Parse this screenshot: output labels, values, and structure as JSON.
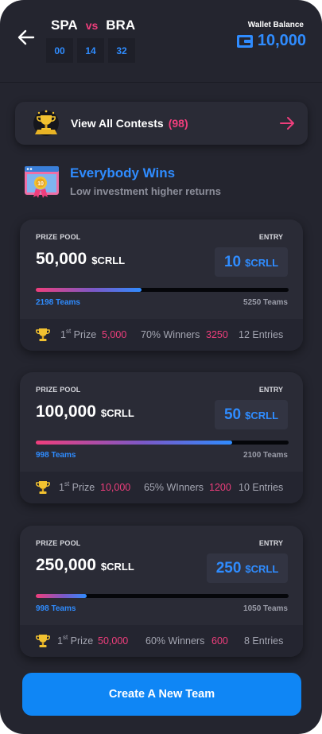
{
  "header": {
    "team_a": "SPA",
    "vs": "vs",
    "team_b": "BRA",
    "timer": [
      "00",
      "14",
      "32"
    ],
    "wallet_label": "Wallet Balance",
    "wallet_amount": "10,000"
  },
  "contests_bar": {
    "label": "View All Contests",
    "count": "(98)"
  },
  "section": {
    "title": "Everybody Wins",
    "subtitle": "Low investment higher returns"
  },
  "labels": {
    "prize_pool": "PRIZE POOL",
    "entry": "ENTRY",
    "currency": "$CRLL",
    "prize_prefix": "1",
    "prize_sup": "st",
    "prize_word": "Prize"
  },
  "cards": [
    {
      "prize_pool": "50,000",
      "entry_amount": "10",
      "filled_teams": "2198 Teams",
      "total_teams": "5250 Teams",
      "fill_fraction": 0.4187,
      "first_prize": "5,000",
      "winners_label": "70% Winners",
      "winners_count": "3250",
      "entries": "12 Entries"
    },
    {
      "prize_pool": "100,000",
      "entry_amount": "50",
      "filled_teams": "998 Teams",
      "total_teams": "2100 Teams",
      "fill_fraction": 0.7752,
      "first_prize": "10,000",
      "winners_label": "65% WInners",
      "winners_count": "1200",
      "entries": "10 Entries"
    },
    {
      "prize_pool": "250,000",
      "entry_amount": "250",
      "filled_teams": "998 Teams",
      "total_teams": "1050 Teams",
      "fill_fraction": 0.2,
      "first_prize": "50,000",
      "winners_label": "60% Winners",
      "winners_count": "600",
      "entries": "8 Entries"
    }
  ],
  "create_button": "Create A New Team",
  "colors": {
    "background": "#24252f",
    "card": "#2a2b36",
    "accent_blue": "#2f8cff",
    "accent_pink": "#ef3e7c",
    "button_blue": "#0f86f5"
  }
}
